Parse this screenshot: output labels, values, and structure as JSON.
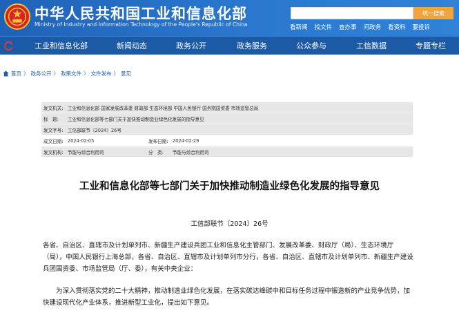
{
  "header": {
    "title": "中华人民共和国工业和信息化部",
    "subtitle": "Ministry of Industry and Information Technology of the People's Republic of China",
    "search": {
      "placeholder": "",
      "button_label": "统一搜索"
    },
    "top_links": [
      "看新闻",
      "找文件",
      "查办事",
      "问政务",
      "看资料",
      "要投诉"
    ]
  },
  "nav": {
    "items": [
      "工业和信息化部",
      "新闻动态",
      "政务公开",
      "政务服务",
      "公众参与",
      "工信数据",
      "专题专栏"
    ]
  },
  "breadcrumb": {
    "items": [
      "首页",
      "政务公开",
      "政策文件",
      "文件发布",
      "意见"
    ],
    "separator": "〉"
  },
  "metadata": {
    "issuer": {
      "label": "发文机关:",
      "value": "工业和信息化部 国家发展改革委 财政部 生态环境部 中国人民银行 国务院国资委 市场监管总局"
    },
    "title": {
      "label": "标　题:",
      "value": "工业和信息化部等七部门关于加快推动制造业绿色化发展的指导意见"
    },
    "doc_number": {
      "label": "发文字号:",
      "value": "工信部联节〔2024〕26号"
    },
    "written_date": {
      "label": "成文日期:",
      "value": "2024-02-05"
    },
    "publish_date": {
      "label": "发布日期:",
      "value": "2024-02-29"
    },
    "publisher": {
      "label": "发文机构:",
      "value": "节能与综合利用司"
    },
    "category": {
      "label": "分　类:",
      "value": "节能与综合利用司"
    }
  },
  "article": {
    "title": "工业和信息化部等七部门关于加快推动制造业绿色化发展的指导意见",
    "doc_number": "工信部联节〔2024〕26号",
    "paragraphs": [
      "各省、自治区、直辖市及计划单列市、新疆生产建设兵团工业和信息化主管部门、发展改革委、财政厅（局）、生态环境厅（局），中国人民银行上海总部，各省、自治区、直辖市及计划单列市分行，各省、自治区、直辖市及计划单列市、新疆生产建设兵团国资委、市场监管局（厅、委），有关中央企业：",
      "为深入贯彻落实党的二十大精神，推动制造业绿色化发展，在落实碳达峰碳中和目标任务过程中锻造新的产业竞争优势，加快建设现代化产业体系，推进新型工业化，提出如下意见。"
    ]
  },
  "colors": {
    "header": "#2a78cf",
    "nav": "#1c5aa8",
    "search_button": "#f2a33a",
    "link": "#1d5bb0"
  },
  "icons": [
    "national-emblem-icon",
    "nav-logo-icon",
    "home-icon"
  ]
}
